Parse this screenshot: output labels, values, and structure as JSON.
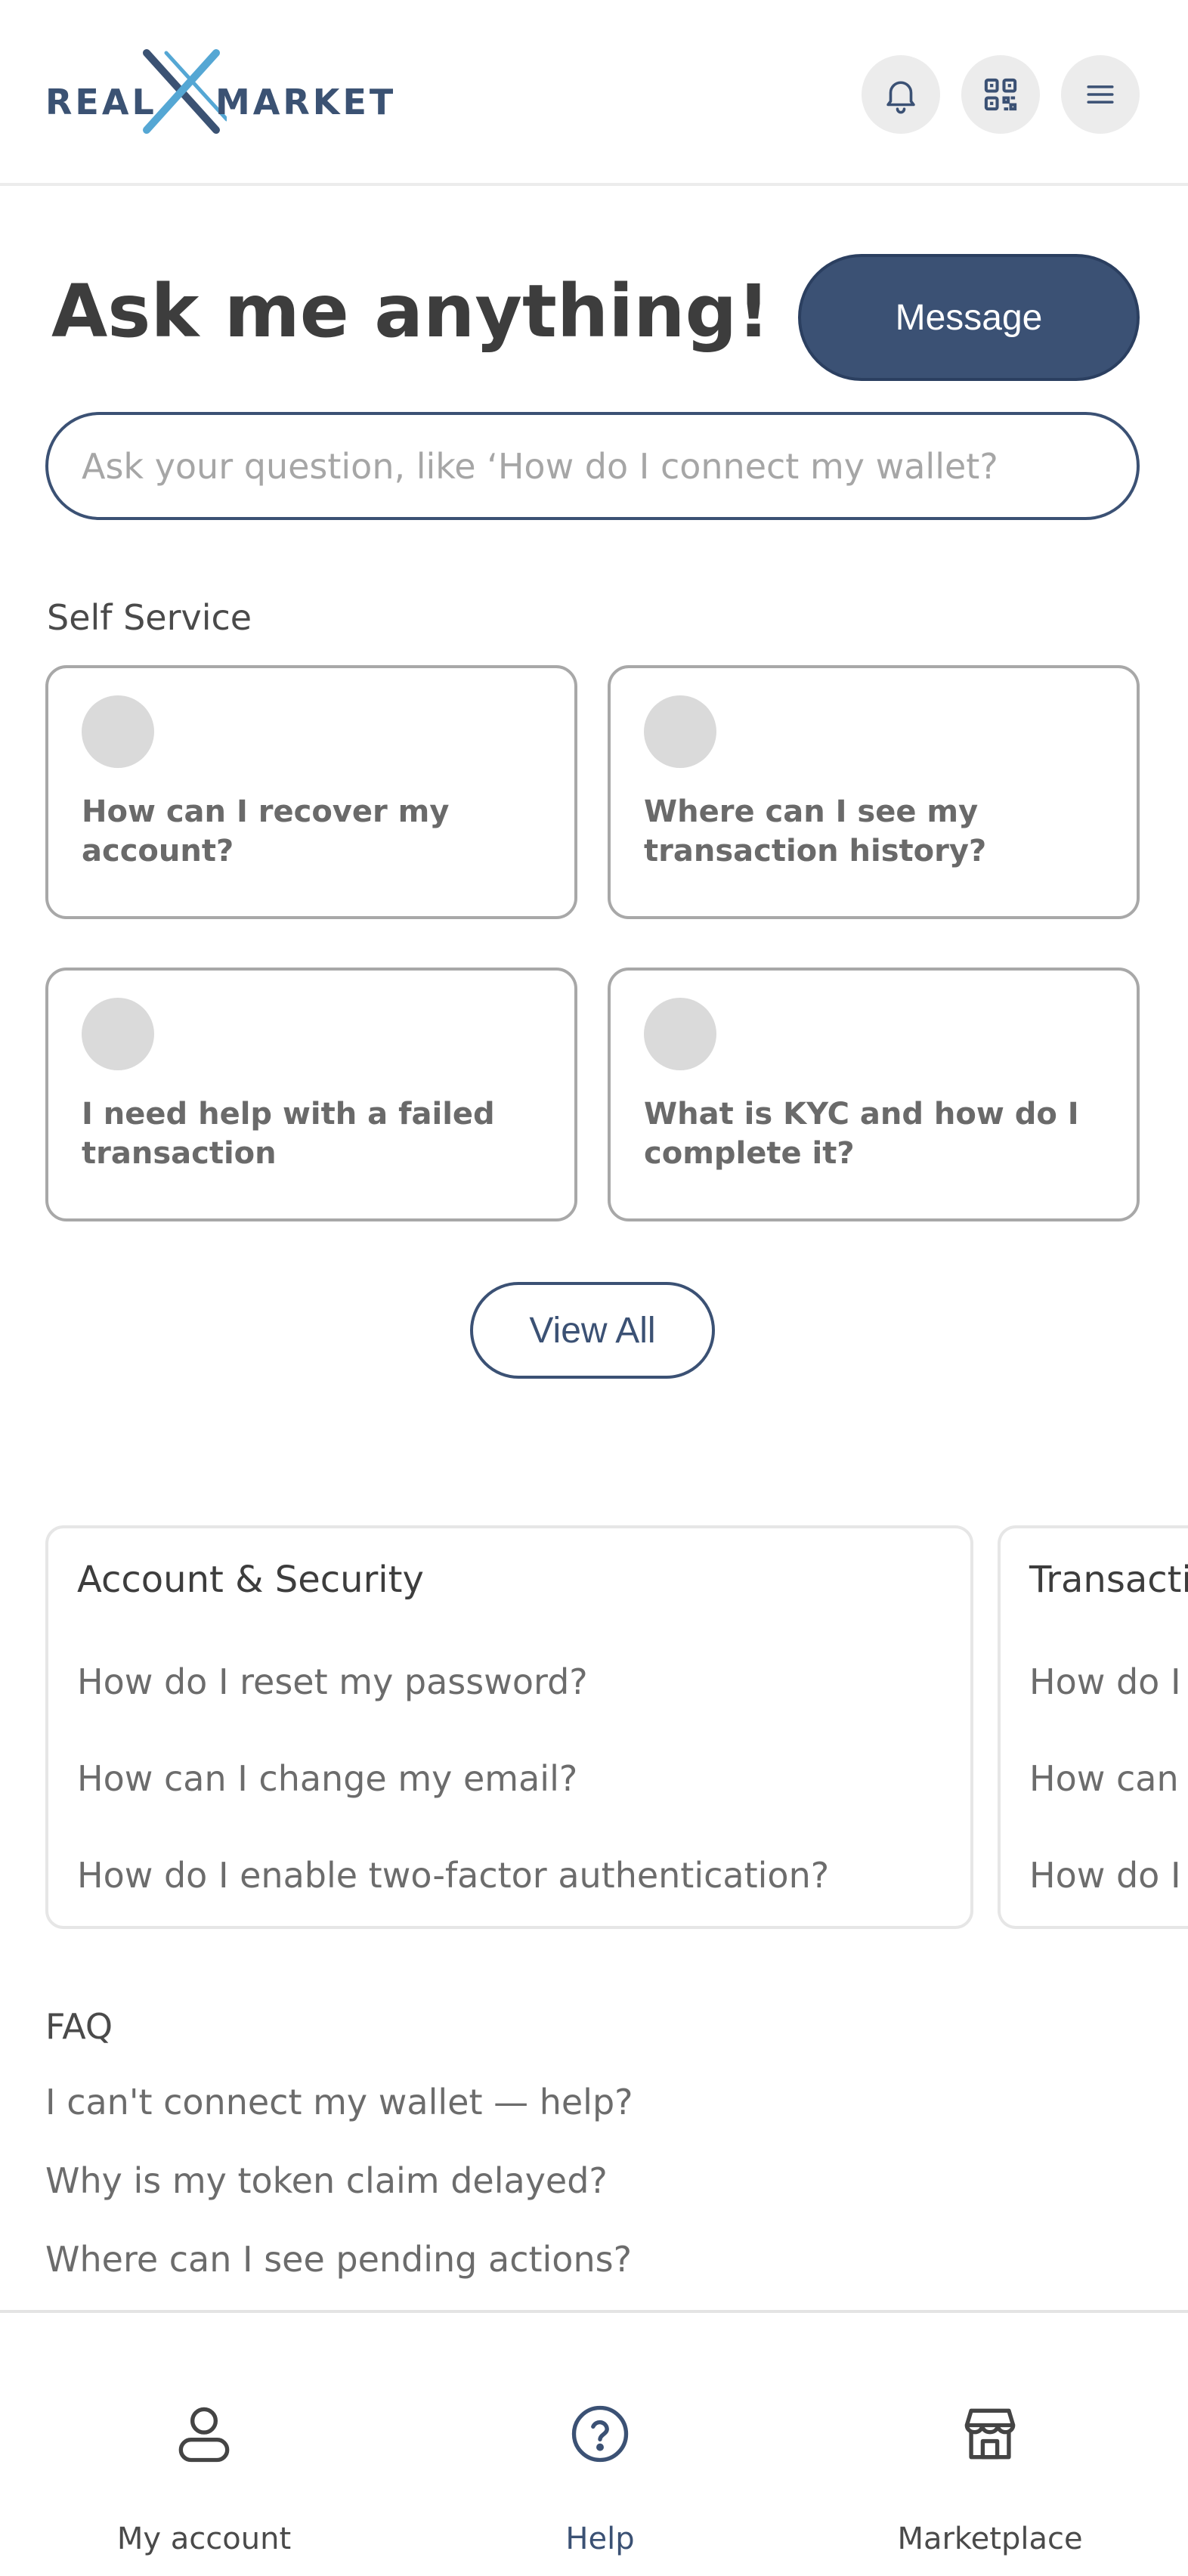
{
  "header": {
    "logo_left": "REAL",
    "logo_right": "MARKET",
    "icons": [
      "bell-icon",
      "qr-code-icon",
      "menu-icon"
    ]
  },
  "hero": {
    "title": "Ask me anything!",
    "message_button": "Message",
    "search_placeholder": "Ask your question, like ‘How do I connect my wallet?"
  },
  "self_service": {
    "label": "Self Service",
    "cards": [
      {
        "text": "How can I recover my account?"
      },
      {
        "text": "Where can I see my transaction history?"
      },
      {
        "text": "I need help with a failed transaction"
      },
      {
        "text": "What is KYC and how do I complete it?"
      }
    ],
    "view_all": "View All"
  },
  "categories": [
    {
      "title": "Account & Security",
      "items": [
        "How do I reset my password?",
        "How can I change my email?",
        "How do I enable two-factor authentication?"
      ]
    },
    {
      "title": "Transacti",
      "items": [
        "How do I r",
        "How can I",
        "How do I c"
      ]
    }
  ],
  "faq": {
    "label": "FAQ",
    "items": [
      "I can't connect my wallet — help?",
      "Why is my token claim delayed?",
      "Where can I see pending actions?"
    ]
  },
  "bottom_nav": {
    "items": [
      {
        "label": "My account",
        "icon": "user-icon"
      },
      {
        "label": "Help",
        "icon": "help-circle-icon",
        "active": true
      },
      {
        "label": "Marketplace",
        "icon": "store-icon"
      }
    ]
  },
  "colors": {
    "brand": "#3b5174",
    "brand_light": "#55a7d4",
    "card_border": "#a8a8a8",
    "muted_text": "#6c6c6c"
  }
}
